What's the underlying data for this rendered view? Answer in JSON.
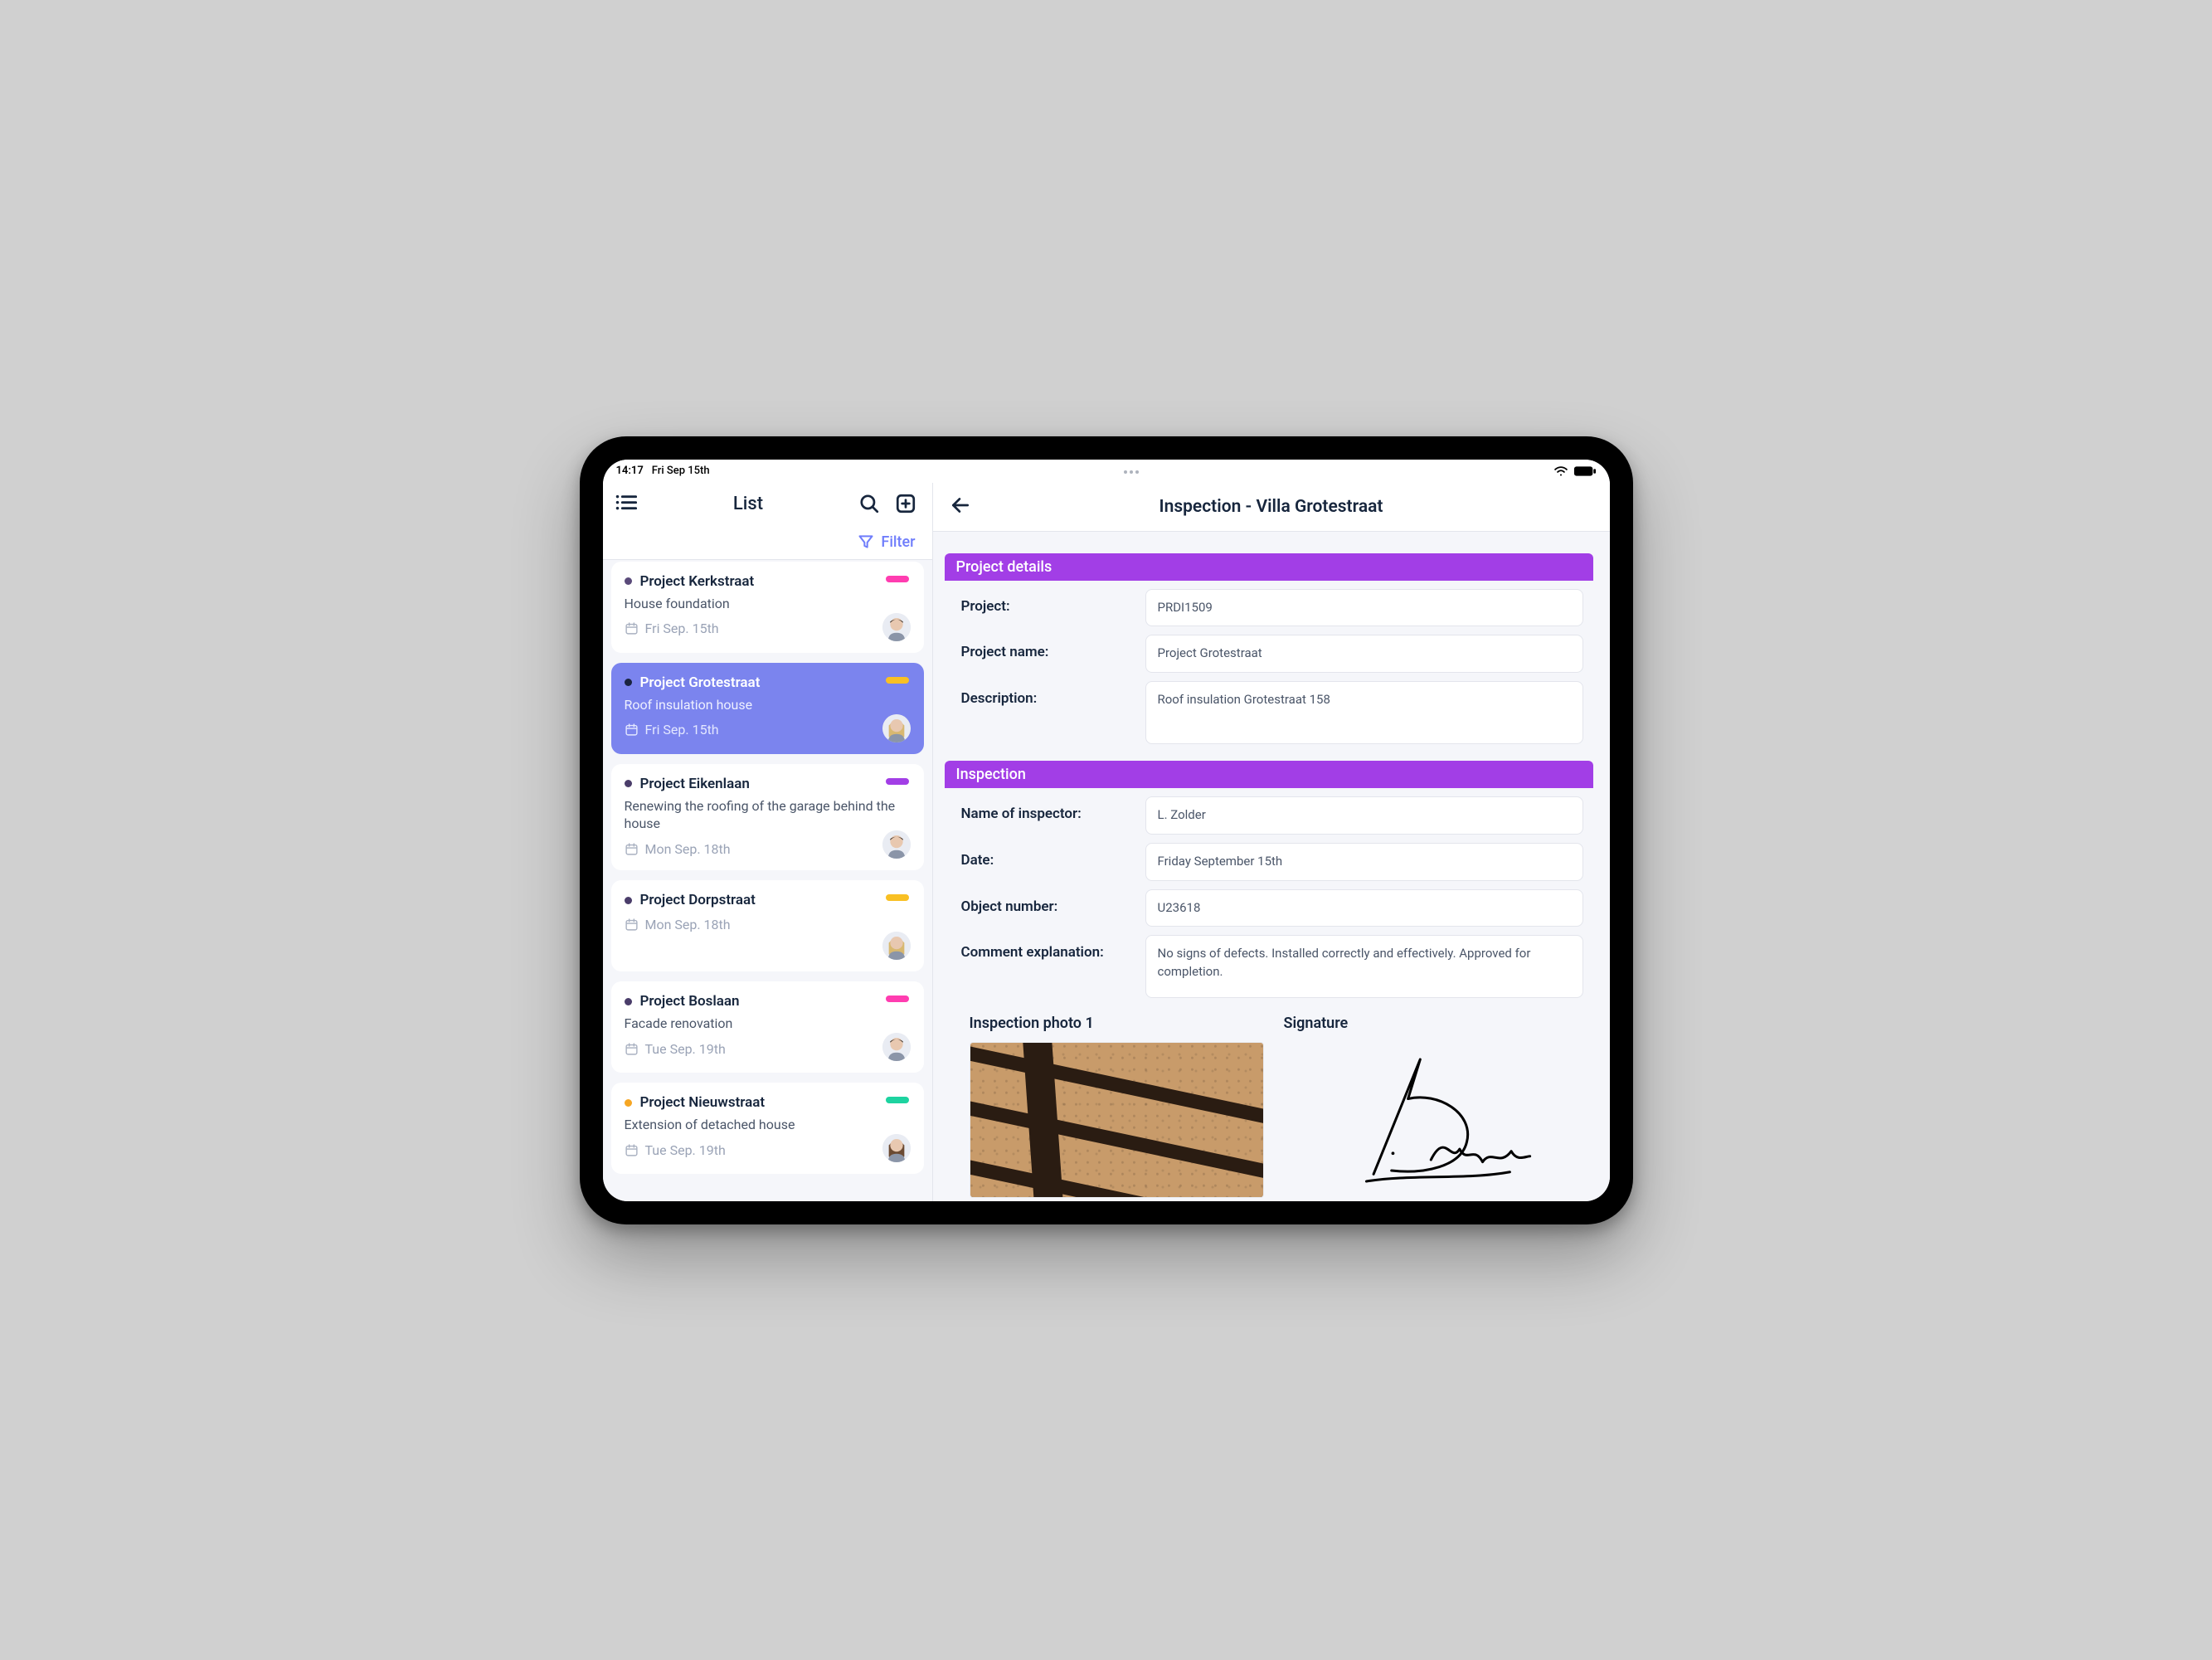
{
  "status_bar": {
    "time": "14:17",
    "date": "Fri Sep 15th"
  },
  "sidebar": {
    "title": "List",
    "filter_label": "Filter",
    "items": [
      {
        "title": "Project Kerkstraat",
        "desc": "House foundation",
        "date": "Fri Sep. 15th",
        "dot": "#5a4a7a",
        "pill": "#ff3db0",
        "avatar": "m-dark",
        "selected": false
      },
      {
        "title": "Project Grotestraat",
        "desc": "Roof insulation house",
        "date": "Fri Sep. 15th",
        "dot": "#1a2440",
        "pill": "#f9c023",
        "avatar": "f-blonde",
        "selected": true
      },
      {
        "title": "Project Eikenlaan",
        "desc": "Renewing the roofing of the garage behind the house",
        "date": "Mon Sep. 18th",
        "dot": "#4a3d6a",
        "pill": "#a23ee6",
        "avatar": "m-dark",
        "selected": false
      },
      {
        "title": "Project Dorpstraat",
        "desc": "",
        "date": "Mon Sep. 18th",
        "dot": "#4a3d6a",
        "pill": "#f9c023",
        "avatar": "f-blonde2",
        "selected": false
      },
      {
        "title": "Project Boslaan",
        "desc": "Facade renovation",
        "date": "Tue Sep. 19th",
        "dot": "#4a3d6a",
        "pill": "#ff3db0",
        "avatar": "m-dark",
        "selected": false
      },
      {
        "title": "Project Nieuwstraat",
        "desc": "Extension of detached house",
        "date": "Tue Sep. 19th",
        "dot": "#f6a623",
        "pill": "#1dd3a0",
        "avatar": "f-brown",
        "selected": false
      }
    ]
  },
  "main": {
    "title": "Inspection - Villa Grotestraat",
    "sections": {
      "project_details": {
        "header": "Project details",
        "rows": [
          {
            "label": "Project:",
            "value": "PRDI1509"
          },
          {
            "label": "Project name:",
            "value": "Project Grotestraat"
          },
          {
            "label": "Description:",
            "value": "Roof insulation Grotestraat 158",
            "multi": true
          }
        ]
      },
      "inspection": {
        "header": "Inspection",
        "rows": [
          {
            "label": "Name of inspector:",
            "value": "L. Zolder"
          },
          {
            "label": "Date:",
            "value": "Friday September 15th"
          },
          {
            "label": "Object number:",
            "value": "U23618"
          },
          {
            "label": "Comment explanation:",
            "value": "No signs of defects. Installed correctly and effectively. Approved for completion.",
            "multi": true
          }
        ]
      }
    },
    "media": {
      "photo_title": "Inspection photo 1",
      "signature_title": "Signature"
    }
  }
}
